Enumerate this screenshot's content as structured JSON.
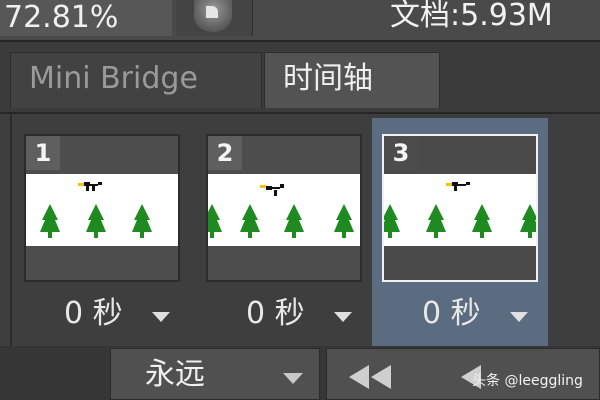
{
  "status": {
    "zoom": "72.81%",
    "doc_size": "文档:5.93M"
  },
  "tabs": [
    {
      "label": "Mini Bridge",
      "active": false
    },
    {
      "label": "时间轴",
      "active": true
    }
  ],
  "frames": [
    {
      "number": "1",
      "delay": "0 秒",
      "selected": false
    },
    {
      "number": "2",
      "delay": "0 秒",
      "selected": false
    },
    {
      "number": "3",
      "delay": "0 秒",
      "selected": true
    }
  ],
  "playback": {
    "loop": "永远"
  },
  "watermark": "头条 @leeggling",
  "colors": {
    "selected_frame": "#5c6c80",
    "tree": "#1f8a1f",
    "bird_beak": "#f5c400"
  }
}
